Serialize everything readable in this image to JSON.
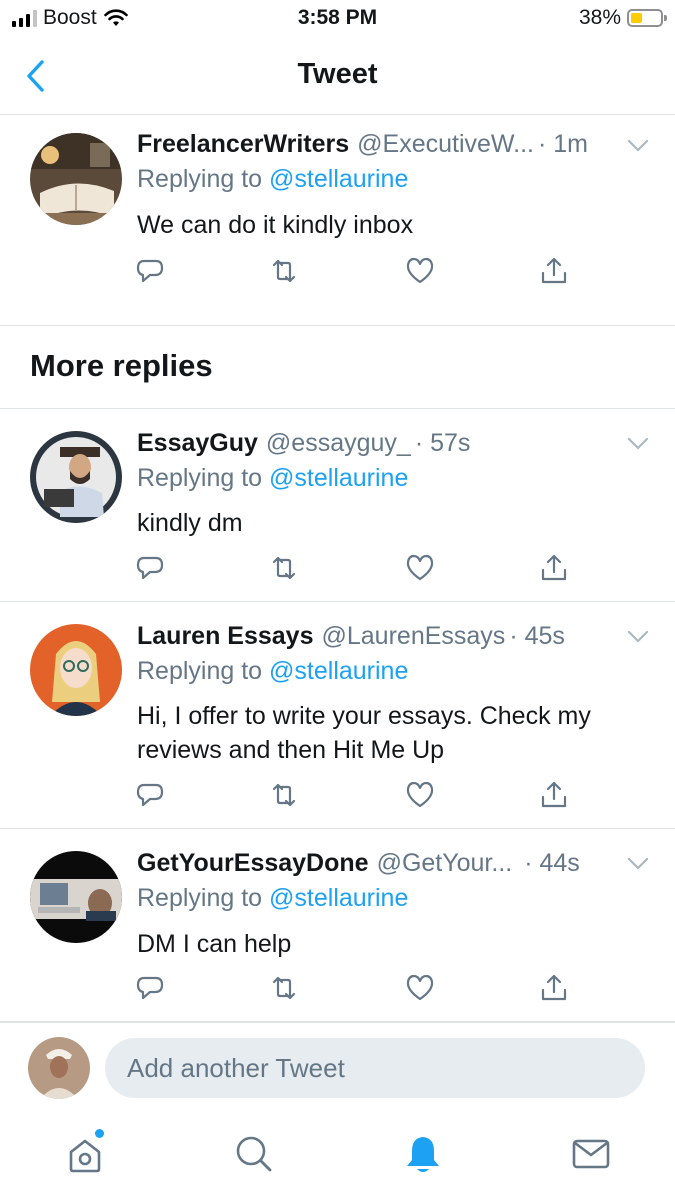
{
  "status_bar": {
    "carrier": "Boost",
    "time": "3:58 PM",
    "battery": "38%",
    "battery_level": 0.38,
    "icons": [
      "signal-icon",
      "wifi-icon",
      "battery-icon"
    ]
  },
  "header": {
    "title": "Tweet",
    "back_icon": "chevron-left-icon"
  },
  "top_reply": {
    "name": "FreelancerWriters",
    "handle": "@ExecutiveW...",
    "time": "· 1m",
    "replying_prefix": "Replying to",
    "replying_to": "@stellaurine",
    "text": "We can do it kindly inbox"
  },
  "more_replies": {
    "title": "More replies",
    "items": [
      {
        "name": "EssayGuy",
        "handle": "@essayguy_",
        "time": "· 57s",
        "replying_prefix": "Replying to",
        "replying_to": "@stellaurine",
        "text": "kindly dm"
      },
      {
        "name": "Lauren Essays",
        "handle": "@LaurenEssays",
        "time": "· 45s",
        "replying_prefix": "Replying to",
        "replying_to": "@stellaurine",
        "text": "Hi, I offer to write your essays. Check my reviews and then Hit Me Up"
      },
      {
        "name": "GetYourEssayDone",
        "handle": "@GetYour...",
        "time": "· 44s",
        "replying_prefix": "Replying to",
        "replying_to": "@stellaurine",
        "text": "DM I can help"
      }
    ]
  },
  "actions": [
    "reply-icon",
    "retweet-icon",
    "like-icon",
    "share-icon"
  ],
  "compose": {
    "placeholder": "Add another Tweet"
  },
  "tab_bar": {
    "items": [
      "home-icon",
      "search-icon",
      "notifications-icon",
      "messages-icon"
    ],
    "active": "notifications-icon"
  },
  "colors": {
    "accent": "#1da1f2",
    "text": "#14171a",
    "muted": "#657786",
    "divider": "#dfe3e6",
    "battery_fill": "#ffcc00"
  }
}
